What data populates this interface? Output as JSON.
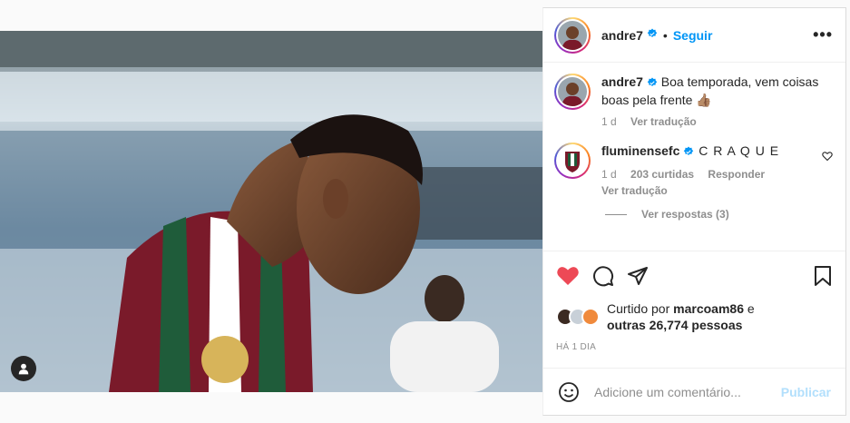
{
  "post": {
    "image_alt": "Fluminense player looking down in stadium",
    "tag_icon": "person-tag-icon"
  },
  "header": {
    "username": "andre7",
    "dot": "•",
    "follow_label": "Seguir",
    "more_label": "•••"
  },
  "caption": {
    "username": "andre7",
    "text": " Boa temporada, vem coisas boas pela frente 👍🏽",
    "time": "1 d",
    "translate_label": "Ver tradução"
  },
  "comments": [
    {
      "username": "fluminensefc",
      "text": " C R A Q U E",
      "time": "1 d",
      "likes": "203 curtidas",
      "reply_label": "Responder",
      "translate_label": "Ver tradução",
      "view_replies": "Ver respostas (3)"
    }
  ],
  "likes": {
    "prefix": "Curtido por ",
    "user": "marcoam86",
    "middle": " e",
    "others": "outras 26,774 pessoas"
  },
  "timestamp": "HÁ 1 DIA",
  "comment_input": {
    "placeholder": "Adicione um comentário...",
    "publish_label": "Publicar"
  },
  "colors": {
    "like_red": "#ed4956",
    "link_blue": "#0095f6",
    "publish_disabled": "#b2dffc",
    "verified_blue": "#0095f6"
  }
}
